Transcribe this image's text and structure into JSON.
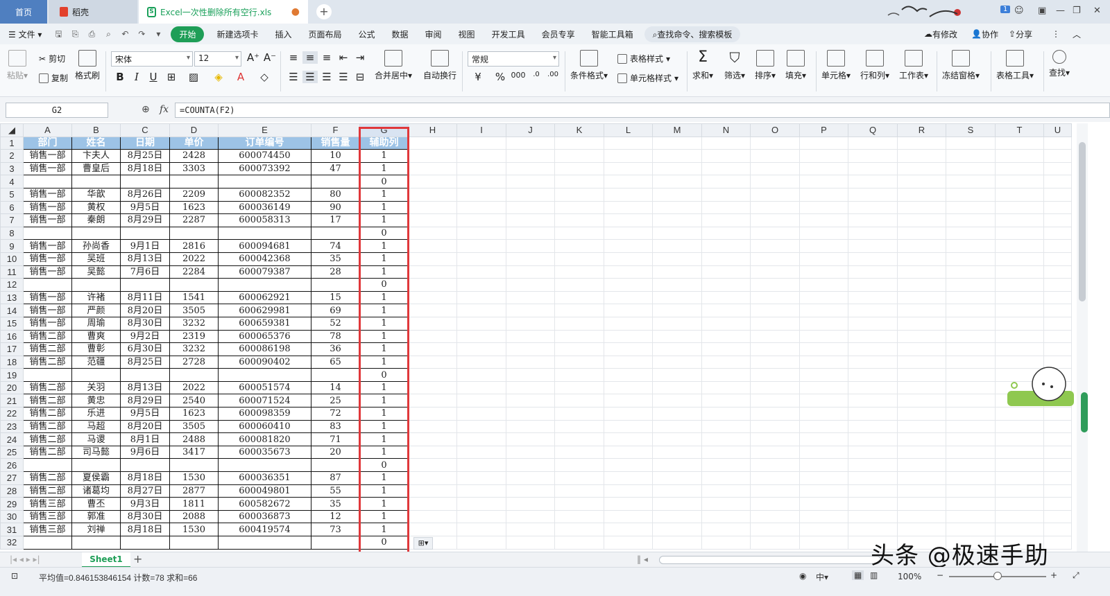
{
  "tabs": {
    "home": "首页",
    "daoke": "稻壳",
    "file": "Excel一次性删除所有空行.xls",
    "unsaved_dot": "●",
    "new_tab": "+"
  },
  "badge": "1",
  "menu": {
    "file": "文件",
    "items": [
      "开始",
      "新建选项卡",
      "插入",
      "页面布局",
      "公式",
      "数据",
      "审阅",
      "视图",
      "开发工具",
      "会员专享",
      "智能工具箱"
    ],
    "search": "查找命令、搜索模板",
    "modified": "有修改",
    "collab": "协作",
    "share": "分享"
  },
  "ribbon": {
    "paste": "粘贴",
    "cut": "剪切",
    "copy": "复制",
    "format_painter": "格式刷",
    "font_name": "宋体",
    "font_size": "12",
    "merge": "合并居中",
    "wrap": "自动换行",
    "number_format": "常规",
    "cond_format": "条件格式",
    "table_style": "表格样式",
    "cell_style": "单元格样式",
    "sum": "求和",
    "filter": "筛选",
    "sort": "排序",
    "fill": "填充",
    "cell": "单元格",
    "row_col": "行和列",
    "worksheet": "工作表",
    "freeze": "冻结窗格",
    "table_tools": "表格工具",
    "find": "查找"
  },
  "formula_bar": {
    "name_box": "G2",
    "fx": "fx",
    "formula": "=COUNTA(F2)"
  },
  "columns": [
    "A",
    "B",
    "C",
    "D",
    "E",
    "F",
    "G",
    "H",
    "I",
    "J",
    "K",
    "L",
    "M",
    "N",
    "O",
    "P",
    "Q",
    "R",
    "S",
    "T",
    "U"
  ],
  "header_row": [
    "部门",
    "姓名",
    "日期",
    "单价",
    "订单编号",
    "销售量",
    "辅助列"
  ],
  "rows": [
    [
      "销售一部",
      "卞夫人",
      "8月25日",
      "2428",
      "600074450",
      "10",
      "1"
    ],
    [
      "销售一部",
      "曹皇后",
      "8月18日",
      "3303",
      "600073392",
      "47",
      "1"
    ],
    [
      "",
      "",
      "",
      "",
      "",
      "",
      "0"
    ],
    [
      "销售一部",
      "华歆",
      "8月26日",
      "2209",
      "600082352",
      "80",
      "1"
    ],
    [
      "销售一部",
      "黄权",
      "9月5日",
      "1623",
      "600036149",
      "90",
      "1"
    ],
    [
      "销售一部",
      "秦朗",
      "8月29日",
      "2287",
      "600058313",
      "17",
      "1"
    ],
    [
      "",
      "",
      "",
      "",
      "",
      "",
      "0"
    ],
    [
      "销售一部",
      "孙尚香",
      "9月1日",
      "2816",
      "600094681",
      "74",
      "1"
    ],
    [
      "销售一部",
      "吴班",
      "8月13日",
      "2022",
      "600042368",
      "35",
      "1"
    ],
    [
      "销售一部",
      "吴懿",
      "7月6日",
      "2284",
      "600079387",
      "28",
      "1"
    ],
    [
      "",
      "",
      "",
      "",
      "",
      "",
      "0"
    ],
    [
      "销售一部",
      "许褚",
      "8月11日",
      "1541",
      "600062921",
      "15",
      "1"
    ],
    [
      "销售一部",
      "严颜",
      "8月20日",
      "3505",
      "600629981",
      "69",
      "1"
    ],
    [
      "销售一部",
      "周瑜",
      "8月30日",
      "3232",
      "600659381",
      "52",
      "1"
    ],
    [
      "销售二部",
      "曹爽",
      "9月2日",
      "2319",
      "600065376",
      "78",
      "1"
    ],
    [
      "销售二部",
      "曹彰",
      "6月30日",
      "3232",
      "600086198",
      "36",
      "1"
    ],
    [
      "销售二部",
      "范疆",
      "8月25日",
      "2728",
      "600090402",
      "65",
      "1"
    ],
    [
      "",
      "",
      "",
      "",
      "",
      "",
      "0"
    ],
    [
      "销售二部",
      "关羽",
      "8月13日",
      "2022",
      "600051574",
      "14",
      "1"
    ],
    [
      "销售二部",
      "黄忠",
      "8月29日",
      "2540",
      "600071524",
      "25",
      "1"
    ],
    [
      "销售二部",
      "乐进",
      "9月5日",
      "1623",
      "600098359",
      "72",
      "1"
    ],
    [
      "销售二部",
      "马超",
      "8月20日",
      "3505",
      "600060410",
      "83",
      "1"
    ],
    [
      "销售二部",
      "马谡",
      "8月1日",
      "2488",
      "600081820",
      "71",
      "1"
    ],
    [
      "销售二部",
      "司马懿",
      "9月6日",
      "3417",
      "600035673",
      "20",
      "1"
    ],
    [
      "",
      "",
      "",
      "",
      "",
      "",
      "0"
    ],
    [
      "销售二部",
      "夏侯霸",
      "8月18日",
      "1530",
      "600036351",
      "87",
      "1"
    ],
    [
      "销售二部",
      "诸葛均",
      "8月27日",
      "2877",
      "600049801",
      "55",
      "1"
    ],
    [
      "销售三部",
      "曹丕",
      "9月3日",
      "1811",
      "600582672",
      "35",
      "1"
    ],
    [
      "销售三部",
      "郭准",
      "8月30日",
      "2088",
      "600036873",
      "12",
      "1"
    ],
    [
      "销售三部",
      "刘禅",
      "8月18日",
      "1530",
      "600419574",
      "73",
      "1"
    ],
    [
      "",
      "",
      "",
      "",
      "",
      "",
      "0"
    ]
  ],
  "sheet_tab": "Sheet1",
  "status": {
    "summary": "平均值=0.846153846154  计数=78  求和=66",
    "zoom": "100%"
  },
  "watermark": "头条 @极速手助",
  "colors": {
    "accent_green": "#1e9e57",
    "header_fill": "#9dc3e6",
    "highlight_red": "#e0383b"
  }
}
